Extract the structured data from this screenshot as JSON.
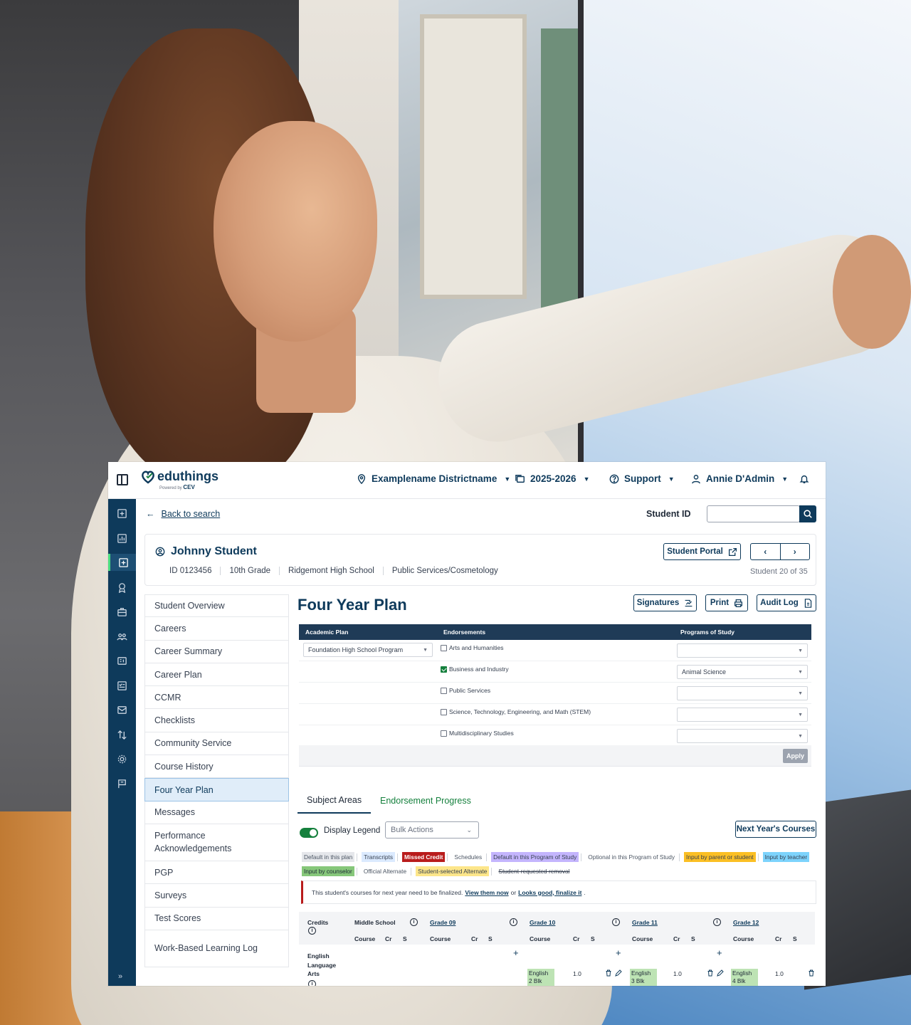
{
  "header": {
    "logo_text": "eduthings",
    "logo_powered": "Powered by",
    "logo_brand": "CEV",
    "district": "Examplename Districtname",
    "year": "2025-2026",
    "support": "Support",
    "user": "Annie D'Admin"
  },
  "search": {
    "back_label": "Back to search",
    "student_id_label": "Student ID",
    "student_id_value": ""
  },
  "student": {
    "name": "Johnny Student",
    "id": "ID 0123456",
    "grade": "10th Grade",
    "school": "Ridgemont High School",
    "pathway": "Public Services/Cosmetology",
    "portal_label": "Student Portal",
    "counter": "Student 20 of 35"
  },
  "sidebar": {
    "items": [
      {
        "label": "Student Overview"
      },
      {
        "label": "Careers"
      },
      {
        "label": "Career Summary"
      },
      {
        "label": "Career Plan"
      },
      {
        "label": "CCMR"
      },
      {
        "label": "Checklists"
      },
      {
        "label": "Community Service"
      },
      {
        "label": "Course History"
      },
      {
        "label": "Four Year Plan",
        "selected": true
      },
      {
        "label": "Messages"
      },
      {
        "label": "Performance Acknowledgements"
      },
      {
        "label": "PGP"
      },
      {
        "label": "Surveys"
      },
      {
        "label": "Test Scores"
      },
      {
        "label": "Work-Based Learning Log"
      }
    ]
  },
  "plan": {
    "title": "Four Year Plan",
    "signatures_label": "Signatures",
    "print_label": "Print",
    "audit_label": "Audit Log",
    "col_academic": "Academic Plan",
    "col_endorsements": "Endorsements",
    "col_programs": "Programs of Study",
    "academic_plan_value": "Foundation High School Program",
    "endorsements": [
      {
        "label": "Arts and Humanities",
        "checked": false,
        "program": ""
      },
      {
        "label": "Business and Industry",
        "checked": true,
        "program": "Animal Science"
      },
      {
        "label": "Public Services",
        "checked": false,
        "program": ""
      },
      {
        "label": "Science, Technology, Engineering, and Math (STEM)",
        "checked": false,
        "program": ""
      },
      {
        "label": "Multidisciplinary Studies",
        "checked": false,
        "program": ""
      }
    ],
    "apply_label": "Apply"
  },
  "tabs": {
    "subject_areas": "Subject Areas",
    "endorsement_progress": "Endorsement Progress"
  },
  "controls": {
    "display_legend": "Display Legend",
    "legend_on": true,
    "bulk_actions": "Bulk Actions",
    "next_year": "Next Year's Courses"
  },
  "legend": {
    "row1": [
      {
        "label": "Default in this plan",
        "bg": "#e5e7eb",
        "fg": "#4b5563"
      },
      {
        "label": "Transcripts",
        "bg": "#dbeafe",
        "fg": "#374151"
      },
      {
        "label": "Missed Credit",
        "bg": "#b91c1c",
        "fg": "#ffffff"
      },
      {
        "label": "Schedules",
        "bg": "#ffffff",
        "fg": "#4b5563"
      },
      {
        "label": "Default in this Program of Study",
        "bg": "#c4b5fd",
        "fg": "#374151"
      },
      {
        "label": "Optional in this Program of Study",
        "bg": "#ffffff",
        "fg": "#4b5563"
      },
      {
        "label": "Input by parent or student",
        "bg": "#fbbf24",
        "fg": "#374151"
      },
      {
        "label": "Input by teacher",
        "bg": "#7dd3fc",
        "fg": "#374151"
      }
    ],
    "row2": [
      {
        "label": "Input by counselor",
        "bg": "#86c77a",
        "fg": "#1f2937"
      },
      {
        "label": "Official Alternate",
        "bg": "#ffffff",
        "fg": "#4b5563"
      },
      {
        "label": "Student-selected Alternate",
        "bg": "#fde68a",
        "fg": "#374151"
      },
      {
        "label": "Student-requested removal",
        "bg": "#ffffff",
        "fg": "#374151"
      }
    ]
  },
  "alert": {
    "text": "This student's courses for next year need to be finalized.",
    "view_link": "View them now",
    "or": "or",
    "finalize_link": "Looks good, finalize it",
    "end": "."
  },
  "grid": {
    "credits": "Credits",
    "middle_school": "Middle School",
    "grades": [
      "Grade 09",
      "Grade 10",
      "Grade 11",
      "Grade 12"
    ],
    "col_course": "Course",
    "col_cr": "Cr",
    "col_s": "S",
    "subject": "English Language Arts",
    "courses": [
      {
        "name": "English 2 Blk",
        "cr": "1.0"
      },
      {
        "name": "English 3 Blk",
        "cr": "1.0"
      },
      {
        "name": "English 4 Blk",
        "cr": "1.0"
      }
    ]
  },
  "colors": {
    "brand_navy": "#0e3a5b",
    "accent_green": "#15803d",
    "alert_red": "#b91c1c",
    "selected_bg": "#e0edf9"
  }
}
